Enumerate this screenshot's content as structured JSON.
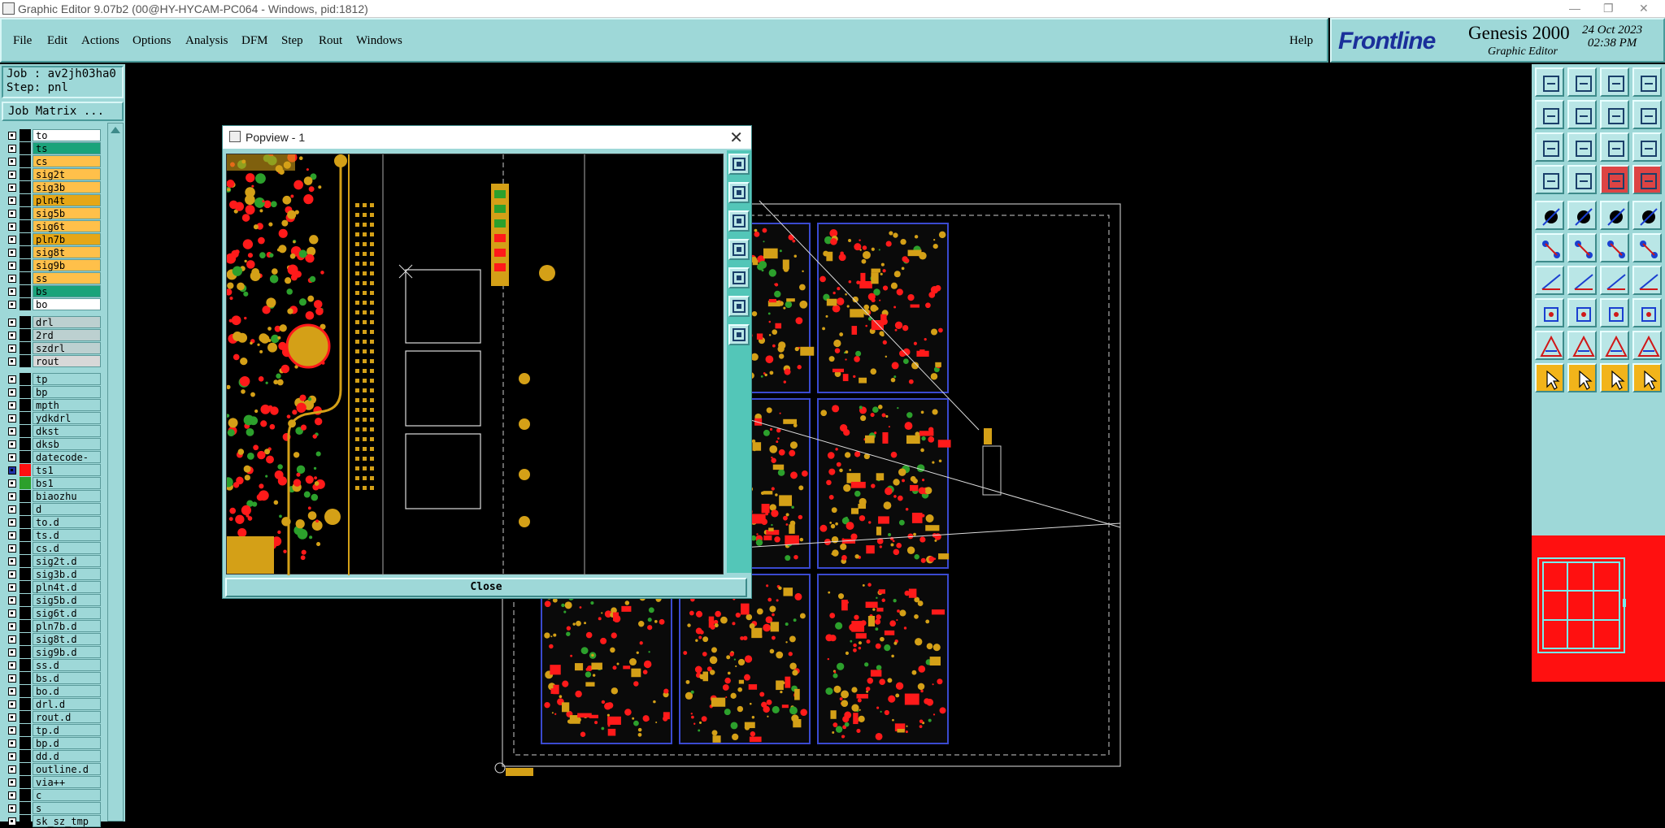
{
  "window": {
    "title": "Graphic Editor 9.07b2 (00@HY-HYCAM-PC064 - Windows, pid:1812)"
  },
  "menu": [
    "File",
    "Edit",
    "Actions",
    "Options",
    "Analysis",
    "DFM",
    "Step",
    "Rout",
    "Windows"
  ],
  "help": "Help",
  "brand": {
    "logo": "Frontline",
    "product": "Genesis 2000",
    "subtitle": "Graphic Editor",
    "date": "24 Oct 2023",
    "time": "02:38 PM"
  },
  "job": {
    "job_line": "Job : av2jh03ha0",
    "step_line": "Step: pnl",
    "matrix_button": "Job Matrix ..."
  },
  "layer_groups": [
    [
      {
        "n": "to",
        "c": "#ffffff"
      },
      {
        "n": "ts",
        "c": "#1aa37a"
      },
      {
        "n": "cs",
        "c": "#ffc04a"
      },
      {
        "n": "sig2t",
        "c": "#ffc04a"
      },
      {
        "n": "sig3b",
        "c": "#ffc04a"
      },
      {
        "n": "pln4t",
        "c": "#e6a717"
      },
      {
        "n": "sig5b",
        "c": "#ffc04a"
      },
      {
        "n": "sig6t",
        "c": "#ffc04a"
      },
      {
        "n": "pln7b",
        "c": "#e6a717"
      },
      {
        "n": "sig8t",
        "c": "#ffc04a"
      },
      {
        "n": "sig9b",
        "c": "#ffc04a"
      },
      {
        "n": "ss",
        "c": "#ffc04a"
      },
      {
        "n": "bs",
        "c": "#1aa37a"
      },
      {
        "n": "bo",
        "c": "#ffffff"
      }
    ],
    [
      {
        "n": "drl",
        "c": "#bcd0d0"
      },
      {
        "n": "2rd",
        "c": "#bcd0d0"
      },
      {
        "n": "szdrl",
        "c": "#bcd0d0"
      },
      {
        "n": "rout",
        "c": "#d8d8d8"
      }
    ],
    [
      {
        "n": "tp",
        "c": "#9ed8d8"
      },
      {
        "n": "bp",
        "c": "#9ed8d8"
      },
      {
        "n": "mpth",
        "c": "#9ed8d8"
      },
      {
        "n": "ydkdrl",
        "c": "#9ed8d8"
      },
      {
        "n": "dkst",
        "c": "#9ed8d8"
      },
      {
        "n": "dksb",
        "c": "#9ed8d8"
      },
      {
        "n": "datecode-bo",
        "c": "#9ed8d8"
      },
      {
        "n": "ts1",
        "c": "#9ed8d8",
        "sw": "#ff1010",
        "active": true
      },
      {
        "n": "bs1",
        "c": "#9ed8d8",
        "sw": "#2ca02c"
      },
      {
        "n": "biaozhu",
        "c": "#9ed8d8"
      },
      {
        "n": "d",
        "c": "#9ed8d8"
      },
      {
        "n": "to.d",
        "c": "#9ed8d8"
      },
      {
        "n": "ts.d",
        "c": "#9ed8d8"
      },
      {
        "n": "cs.d",
        "c": "#9ed8d8"
      },
      {
        "n": "sig2t.d",
        "c": "#9ed8d8"
      },
      {
        "n": "sig3b.d",
        "c": "#9ed8d8"
      },
      {
        "n": "pln4t.d",
        "c": "#9ed8d8"
      },
      {
        "n": "sig5b.d",
        "c": "#9ed8d8"
      },
      {
        "n": "sig6t.d",
        "c": "#9ed8d8"
      },
      {
        "n": "pln7b.d",
        "c": "#9ed8d8"
      },
      {
        "n": "sig8t.d",
        "c": "#9ed8d8"
      },
      {
        "n": "sig9b.d",
        "c": "#9ed8d8"
      },
      {
        "n": "ss.d",
        "c": "#9ed8d8"
      },
      {
        "n": "bs.d",
        "c": "#9ed8d8"
      },
      {
        "n": "bo.d",
        "c": "#9ed8d8"
      },
      {
        "n": "drl.d",
        "c": "#9ed8d8"
      },
      {
        "n": "rout.d",
        "c": "#9ed8d8"
      },
      {
        "n": "tp.d",
        "c": "#9ed8d8"
      },
      {
        "n": "bp.d",
        "c": "#9ed8d8"
      },
      {
        "n": "dd.d",
        "c": "#9ed8d8"
      },
      {
        "n": "outline.d",
        "c": "#9ed8d8"
      },
      {
        "n": "via++",
        "c": "#9ed8d8"
      },
      {
        "n": "c",
        "c": "#9ed8d8"
      },
      {
        "n": "s",
        "c": "#9ed8d8"
      },
      {
        "n": "sk_sz_tmp",
        "c": "#9ed8d8"
      }
    ]
  ],
  "popup": {
    "title": "Popview - 1",
    "close_label": "Close"
  },
  "colors": {
    "panel": "#9ed8d8",
    "copper": "#d4a017",
    "red": "#ff1010",
    "green": "#2ca02c"
  }
}
